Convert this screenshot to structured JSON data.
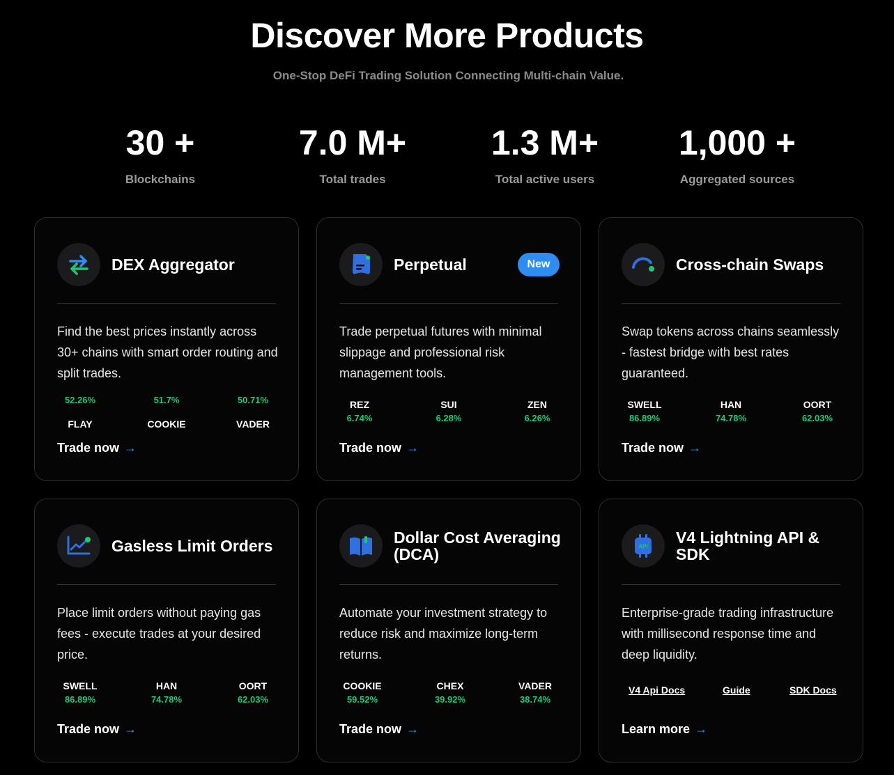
{
  "header": {
    "title": "Discover More Products",
    "subtitle": "One-Stop DeFi Trading Solution Connecting Multi-chain Value."
  },
  "stats": [
    {
      "value": "30 +",
      "label": "Blockchains"
    },
    {
      "value": "7.0 M+",
      "label": "Total trades"
    },
    {
      "value": "1.3 M+",
      "label": "Total active users"
    },
    {
      "value": "1,000 +",
      "label": "Aggregated sources"
    }
  ],
  "cards": [
    {
      "title": "DEX Aggregator",
      "icon": "swap-arrows-icon",
      "description": "Find the best prices instantly across 30+ chains with smart order routing and split trades.",
      "tokens": [
        {
          "name": "FLAY",
          "pct": "52.26%"
        },
        {
          "name": "COOKIE",
          "pct": "51.7%"
        },
        {
          "name": "VADER",
          "pct": "50.71%"
        }
      ],
      "cta": "Trade now"
    },
    {
      "title": "Perpetual",
      "badge": "New",
      "icon": "document-icon",
      "description": "Trade perpetual futures with minimal slippage and professional risk management tools.",
      "tokens": [
        {
          "name": "REZ",
          "pct": "6.74%"
        },
        {
          "name": "SUI",
          "pct": "6.28%"
        },
        {
          "name": "ZEN",
          "pct": "6.26%"
        }
      ],
      "cta": "Trade now"
    },
    {
      "title": "Cross-chain Swaps",
      "icon": "bridge-arc-icon",
      "description": "Swap tokens across chains seamlessly - fastest bridge with best rates guaranteed.",
      "tokens": [
        {
          "name": "SWELL",
          "pct": "86.89%"
        },
        {
          "name": "HAN",
          "pct": "74.78%"
        },
        {
          "name": "OORT",
          "pct": "62.03%"
        }
      ],
      "cta": "Trade now"
    },
    {
      "title": "Gasless Limit Orders",
      "icon": "line-chart-icon",
      "description": "Place limit orders without paying gas fees - execute trades at your desired price.",
      "tokens": [
        {
          "name": "SWELL",
          "pct": "86.89%"
        },
        {
          "name": "HAN",
          "pct": "74.78%"
        },
        {
          "name": "OORT",
          "pct": "62.03%"
        }
      ],
      "cta": "Trade now"
    },
    {
      "title": "Dollar Cost Averaging (DCA)",
      "icon": "open-book-icon",
      "description": "Automate your investment strategy to reduce risk and maximize long-term returns.",
      "tokens": [
        {
          "name": "COOKIE",
          "pct": "59.52%"
        },
        {
          "name": "CHEX",
          "pct": "39.92%"
        },
        {
          "name": "VADER",
          "pct": "38.74%"
        }
      ],
      "cta": "Trade now"
    },
    {
      "title": "V4 Lightning API & SDK",
      "icon": "api-chip-icon",
      "icon_text": "API",
      "description": "Enterprise-grade trading infrastructure with millisecond response time and deep liquidity.",
      "links": [
        "V4 Api Docs",
        "Guide",
        "SDK Docs"
      ],
      "cta": "Learn more"
    }
  ],
  "colors": {
    "background": "#000000",
    "accent_blue": "#2f8cf0",
    "positive_green": "#1fc77a"
  }
}
